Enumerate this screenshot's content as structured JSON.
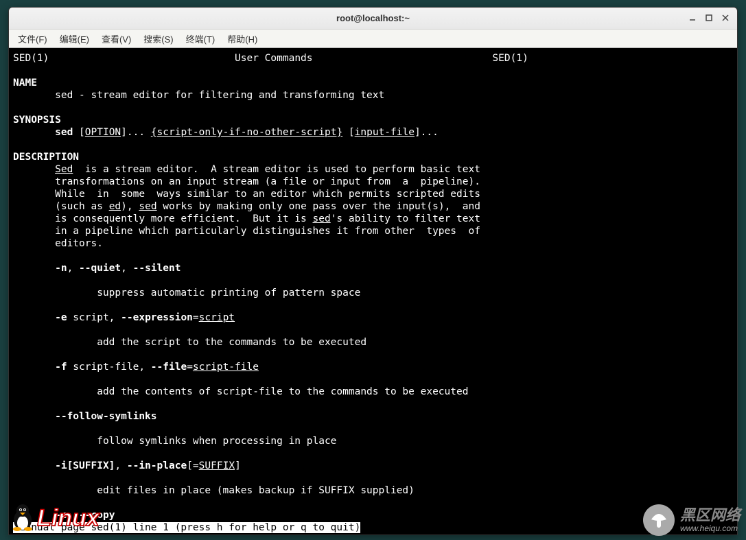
{
  "window": {
    "title": "root@localhost:~"
  },
  "menu": {
    "file": "文件(F)",
    "edit": "编辑(E)",
    "view": "查看(V)",
    "search": "搜索(S)",
    "terminal": "终端(T)",
    "help": "帮助(H)"
  },
  "man": {
    "header_left": "SED(1)",
    "header_center": "User Commands",
    "header_right": "SED(1)",
    "name_hdr": "NAME",
    "name_line": "       sed - stream editor for filtering and transforming text",
    "synopsis_hdr": "SYNOPSIS",
    "syn_sed": "sed",
    "syn_option": "OPTION",
    "syn_script": "{script-only-if-no-other-script}",
    "syn_input": "input-file",
    "desc_hdr": "DESCRIPTION",
    "desc_sed": "Sed",
    "desc_l1a": "  is a stream editor.  A stream editor is used to perform basic text",
    "desc_l2": "       transformations on an input stream (a file or input from  a  pipeline).",
    "desc_l3": "       While  in  some  ways similar to an editor which permits scripted edits",
    "desc_l4a": "       (such as ",
    "desc_ed": "ed",
    "desc_l4b": "), ",
    "desc_sed2": "sed",
    "desc_l4c": " works by making only one pass over the input(s),  and",
    "desc_l5a": "       is consequently more efficient.  But it is ",
    "desc_sed3": "sed",
    "desc_l5b": "'s ability to filter text",
    "desc_l6": "       in a pipeline which particularly distinguishes it from other  types  of",
    "desc_l7": "       editors.",
    "opt_n": "-n",
    "opt_quiet": "--quiet",
    "opt_silent": "--silent",
    "opt_n_desc": "              suppress automatic printing of pattern space",
    "opt_e": "-e",
    "opt_e_arg": " script, ",
    "opt_expr": "--expression",
    "opt_e_script": "script",
    "opt_e_desc": "              add the script to the commands to be executed",
    "opt_f": "-f",
    "opt_f_arg": " script-file, ",
    "opt_file": "--file",
    "opt_f_script": "script-file",
    "opt_f_desc": "              add the contents of script-file to the commands to be executed",
    "opt_follow": "--follow-symlinks",
    "opt_follow_desc": "              follow symlinks when processing in place",
    "opt_i": "-i[SUFFIX]",
    "opt_inplace": "--in-place",
    "opt_i_suffix": "SUFFIX",
    "opt_i_desc": "              edit files in place (makes backup if SUFFIX supplied)",
    "opt_c": "-c",
    "opt_copy": "--copy",
    "status": " Manual page sed(1) line 1 (press h for help or q to quit)"
  },
  "watermark1": {
    "text": "Linux"
  },
  "watermark2": {
    "cn": "黑区网络",
    "url": "www.heiqu.com"
  }
}
